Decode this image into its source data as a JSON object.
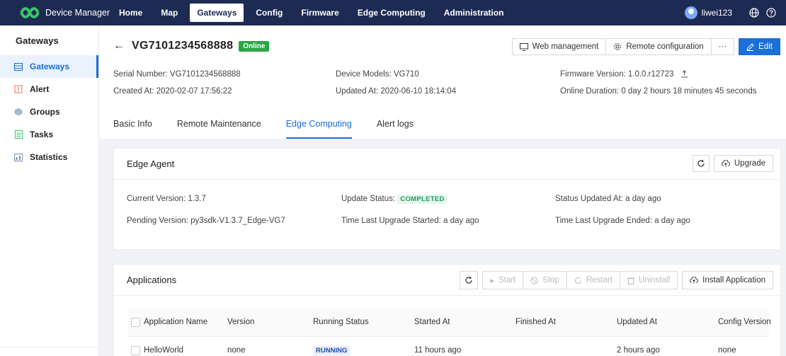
{
  "app": {
    "name": "Device Manager"
  },
  "topnav": {
    "items": [
      "Home",
      "Map",
      "Gateways",
      "Config",
      "Firmware",
      "Edge Computing",
      "Administration"
    ],
    "active": "Gateways",
    "username": "liwei123"
  },
  "sidebar": {
    "title": "Gateways",
    "items": [
      {
        "label": "Gateways",
        "icon": "gateway-icon",
        "active": true
      },
      {
        "label": "Alert",
        "icon": "alert-icon",
        "active": false
      },
      {
        "label": "Groups",
        "icon": "groups-icon",
        "active": false
      },
      {
        "label": "Tasks",
        "icon": "tasks-icon",
        "active": false
      },
      {
        "label": "Statistics",
        "icon": "statistics-icon",
        "active": false
      }
    ]
  },
  "device": {
    "name": "VG7101234568888",
    "status": "Online",
    "serial_label": "Serial Number:",
    "serial": "VG7101234568888",
    "created_label": "Created At:",
    "created": "2020-02-07 17:56:22",
    "model_label": "Device Models:",
    "model": "VG710",
    "updated_label": "Updated At:",
    "updated": "2020-06-10 18:14:04",
    "firmware_label": "Firmware Version:",
    "firmware": "1.0.0.r12723",
    "online_label": "Online Duration:",
    "online_duration": "0 day 2 hours 18 minutes 45 seconds"
  },
  "header_actions": {
    "web_management": "Web management",
    "remote_config": "Remote configuration",
    "more": "···",
    "edit": "Edit"
  },
  "tabs": {
    "items": [
      "Basic Info",
      "Remote Maintenance",
      "Edge Computing",
      "Alert logs"
    ],
    "active": "Edge Computing"
  },
  "edge_agent": {
    "title": "Edge Agent",
    "upgrade": "Upgrade",
    "current_version_label": "Current Version:",
    "current_version": "1.3.7",
    "pending_version_label": "Pending Version:",
    "pending_version": "py3sdk-V1.3.7_Edge-VG7",
    "update_status_label": "Update Status:",
    "update_status": "COMPLETED",
    "last_upgrade_started_label": "Time Last Upgrade Started:",
    "last_upgrade_started": "a day ago",
    "status_updated_label": "Status Updated At:",
    "status_updated": "a day ago",
    "last_upgrade_ended_label": "Time Last Upgrade Ended:",
    "last_upgrade_ended": "a day ago"
  },
  "applications": {
    "title": "Applications",
    "buttons": {
      "start": "Start",
      "stop": "Stop",
      "restart": "Restart",
      "uninstall": "Uninstall",
      "install": "Install Application"
    },
    "columns": [
      "Application Name",
      "Version",
      "Running Status",
      "Started At",
      "Finished At",
      "Updated At",
      "Config Version"
    ],
    "rows": [
      {
        "name": "HelloWorld",
        "version": "none",
        "status": "RUNNING",
        "started": "11 hours ago",
        "finished": "",
        "updated": "2 hours ago",
        "config_version": "none"
      }
    ]
  },
  "colors": {
    "nav_bg": "#1d2b52",
    "primary": "#1a6fd8",
    "online": "#29a745"
  }
}
